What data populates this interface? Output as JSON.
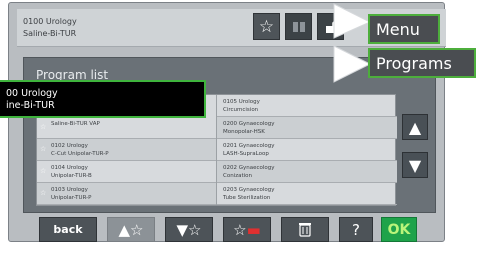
{
  "header": {
    "line1": "0100 Urology",
    "line2": "Saline-Bi-TUR",
    "icons": [
      "star-outline-icon",
      "book-icon",
      "unlock-icon"
    ]
  },
  "panel": {
    "title": "Program list"
  },
  "tooltip": {
    "line1": "00 Urology",
    "line2": "ine-Bi-TUR"
  },
  "left_list": [
    {
      "line1": "",
      "line2": "Saline-Bi-TUR VAP"
    },
    {
      "line1": "0102 Urology",
      "line2": "C-Cut Unipolar-TUR-P"
    },
    {
      "line1": "0104 Urology",
      "line2": "Unipolar-TUR-B"
    },
    {
      "line1": "0103 Urology",
      "line2": "Unipolar-TUR-P"
    }
  ],
  "right_list": [
    {
      "line1": "0105 Urology",
      "line2": "Circumcision"
    },
    {
      "line1": "0200 Gynaecology",
      "line2": "Monopolar-HSK"
    },
    {
      "line1": "0201 Gynaecology",
      "line2": "LASH-SupraLoop"
    },
    {
      "line1": "0202 Gynaecology",
      "line2": "Conization"
    },
    {
      "line1": "0203 Gynaecology",
      "line2": "Tube Sterilization"
    }
  ],
  "buttons": {
    "back": "back",
    "ok": "OK",
    "help": "?"
  },
  "callouts": {
    "menu": "Menu",
    "programs": "Programs"
  },
  "colors": {
    "accent_green": "#1ea34a",
    "callout_border": "#4dae3c"
  }
}
